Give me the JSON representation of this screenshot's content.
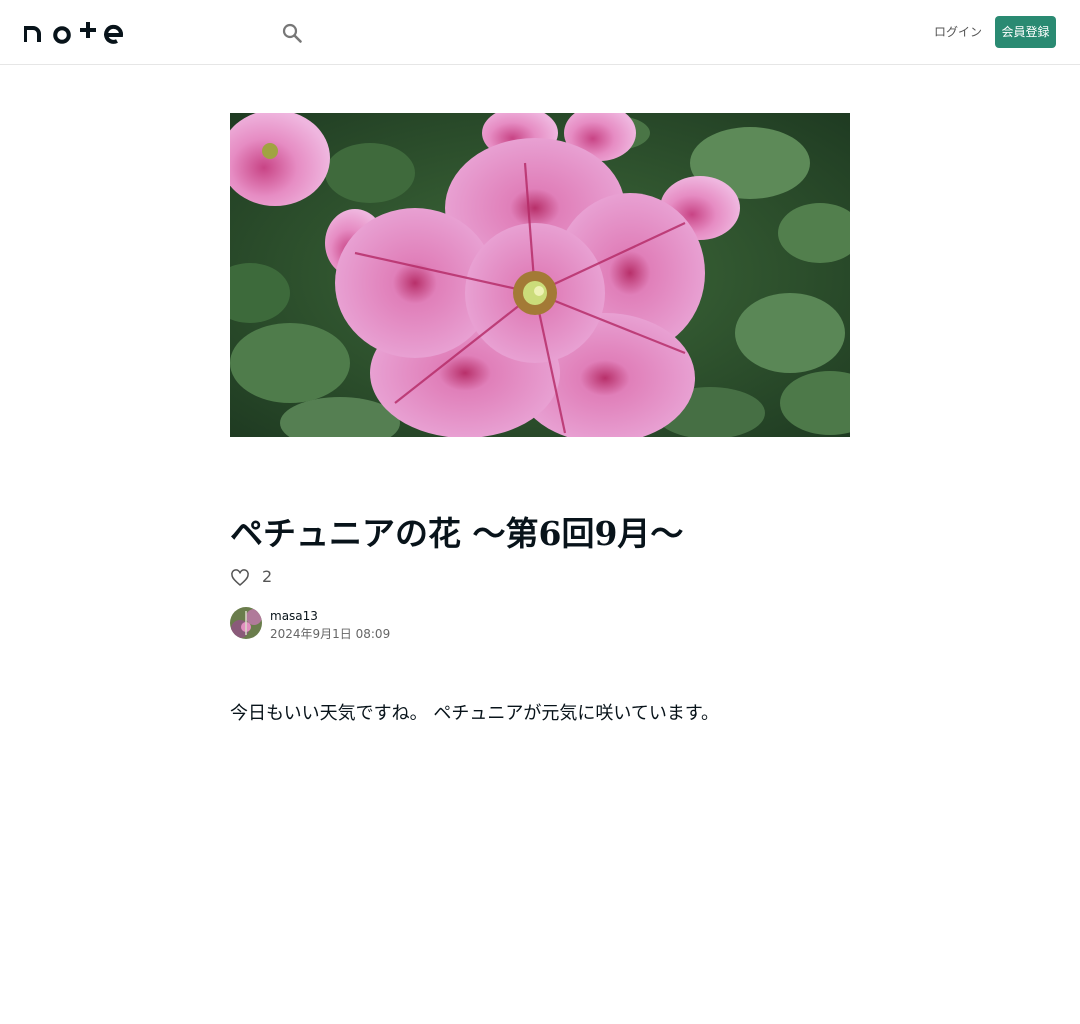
{
  "header": {
    "logo_text": "note",
    "login_label": "ログイン",
    "signup_label": "会員登録",
    "accent_color": "#2a8a72",
    "icons": {
      "search": "search-icon"
    }
  },
  "article": {
    "title": "ペチュニアの花 〜第6回9月〜",
    "like_count": "2",
    "author": {
      "name": "masa13",
      "date": "2024年9月1日 08:09"
    },
    "body": "今日もいい天気ですね。 ペチュニアが元気に咲いています。"
  }
}
